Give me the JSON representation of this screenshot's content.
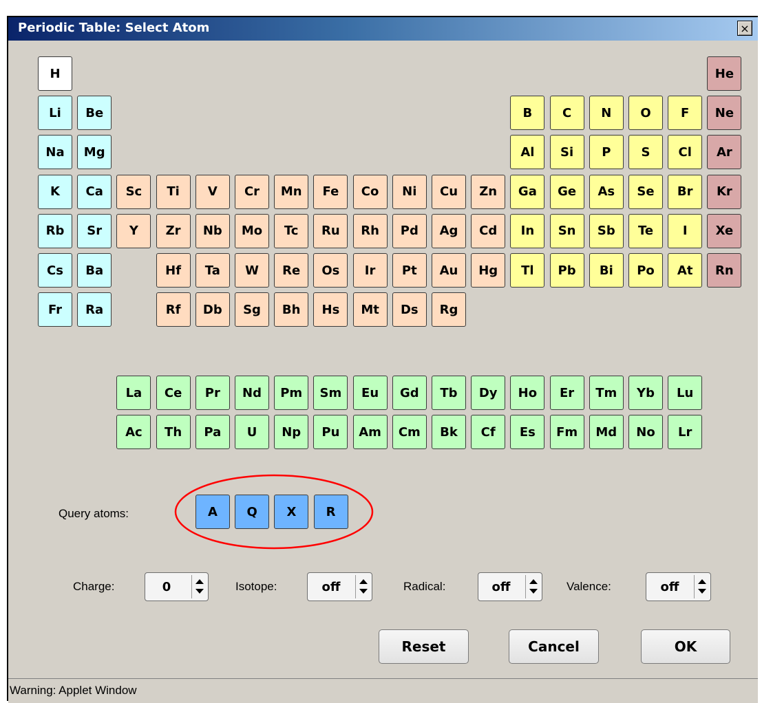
{
  "window": {
    "title": "Periodic Table: Select Atom",
    "close_label": "×"
  },
  "colors": {
    "hydrogen": "#ffffff",
    "alkali": "#ccffff",
    "transition": "#ffdcc0",
    "pblock": "#ffff99",
    "noble": "#d8a8a8",
    "fblock": "#bfffbf",
    "query": "#6eb4ff",
    "annotation": "#ff0000"
  },
  "elements": {
    "row1": [
      "H",
      "He"
    ],
    "row2": [
      "Li",
      "Be",
      "B",
      "C",
      "N",
      "O",
      "F",
      "Ne"
    ],
    "row3": [
      "Na",
      "Mg",
      "Al",
      "Si",
      "P",
      "S",
      "Cl",
      "Ar"
    ],
    "row4": [
      "K",
      "Ca",
      "Sc",
      "Ti",
      "V",
      "Cr",
      "Mn",
      "Fe",
      "Co",
      "Ni",
      "Cu",
      "Zn",
      "Ga",
      "Ge",
      "As",
      "Se",
      "Br",
      "Kr"
    ],
    "row5": [
      "Rb",
      "Sr",
      "Y",
      "Zr",
      "Nb",
      "Mo",
      "Tc",
      "Ru",
      "Rh",
      "Pd",
      "Ag",
      "Cd",
      "In",
      "Sn",
      "Sb",
      "Te",
      "I",
      "Xe"
    ],
    "row6": [
      "Cs",
      "Ba",
      "Hf",
      "Ta",
      "W",
      "Re",
      "Os",
      "Ir",
      "Pt",
      "Au",
      "Hg",
      "Tl",
      "Pb",
      "Bi",
      "Po",
      "At",
      "Rn"
    ],
    "row7": [
      "Fr",
      "Ra",
      "Rf",
      "Db",
      "Sg",
      "Bh",
      "Hs",
      "Mt",
      "Ds",
      "Rg"
    ],
    "lanthanides": [
      "La",
      "Ce",
      "Pr",
      "Nd",
      "Pm",
      "Sm",
      "Eu",
      "Gd",
      "Tb",
      "Dy",
      "Ho",
      "Er",
      "Tm",
      "Yb",
      "Lu"
    ],
    "actinides": [
      "Ac",
      "Th",
      "Pa",
      "U",
      "Np",
      "Pu",
      "Am",
      "Cm",
      "Bk",
      "Cf",
      "Es",
      "Fm",
      "Md",
      "No",
      "Lr"
    ]
  },
  "query": {
    "label": "Query atoms:",
    "atoms": [
      "A",
      "Q",
      "X",
      "R"
    ]
  },
  "options": {
    "charge": {
      "label": "Charge:",
      "value": "0"
    },
    "isotope": {
      "label": "Isotope:",
      "value": "off"
    },
    "radical": {
      "label": "Radical:",
      "value": "off"
    },
    "valence": {
      "label": "Valence:",
      "value": "off"
    }
  },
  "buttons": {
    "reset": "Reset",
    "cancel": "Cancel",
    "ok": "OK"
  },
  "status": "Warning: Applet Window"
}
